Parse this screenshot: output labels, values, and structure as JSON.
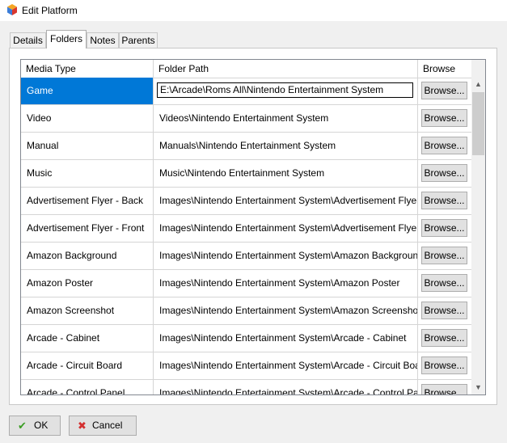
{
  "window": {
    "title": "Edit Platform",
    "icon": "launchbox-cube-icon"
  },
  "tabs": [
    {
      "label": "Details",
      "active": false
    },
    {
      "label": "Folders",
      "active": true
    },
    {
      "label": "Notes",
      "active": false
    },
    {
      "label": "Parents",
      "active": false
    }
  ],
  "grid": {
    "columns": [
      "Media Type",
      "Folder Path",
      "Browse"
    ],
    "rows": [
      {
        "type": "Game",
        "path": "E:\\Arcade\\Roms All\\Nintendo Entertainment System",
        "browse": "Browse...",
        "selected": true
      },
      {
        "type": "Video",
        "path": "Videos\\Nintendo Entertainment System",
        "browse": "Browse..."
      },
      {
        "type": "Manual",
        "path": "Manuals\\Nintendo Entertainment System",
        "browse": "Browse..."
      },
      {
        "type": "Music",
        "path": "Music\\Nintendo Entertainment System",
        "browse": "Browse..."
      },
      {
        "type": "Advertisement Flyer - Back",
        "path": "Images\\Nintendo Entertainment System\\Advertisement Flyer -",
        "browse": "Browse..."
      },
      {
        "type": "Advertisement Flyer - Front",
        "path": "Images\\Nintendo Entertainment System\\Advertisement Flyer -",
        "browse": "Browse..."
      },
      {
        "type": "Amazon Background",
        "path": "Images\\Nintendo Entertainment System\\Amazon Background",
        "browse": "Browse..."
      },
      {
        "type": "Amazon Poster",
        "path": "Images\\Nintendo Entertainment System\\Amazon Poster",
        "browse": "Browse..."
      },
      {
        "type": "Amazon Screenshot",
        "path": "Images\\Nintendo Entertainment System\\Amazon Screenshot",
        "browse": "Browse..."
      },
      {
        "type": "Arcade - Cabinet",
        "path": "Images\\Nintendo Entertainment System\\Arcade - Cabinet",
        "browse": "Browse..."
      },
      {
        "type": "Arcade - Circuit Board",
        "path": "Images\\Nintendo Entertainment System\\Arcade - Circuit Boarc",
        "browse": "Browse..."
      },
      {
        "type": "Arcade - Control Panel",
        "path": "Images\\Nintendo Entertainment System\\Arcade - Control Panc",
        "browse": "Browse..."
      }
    ]
  },
  "footer": {
    "ok_label": "OK",
    "cancel_label": "Cancel",
    "ok_icon": "checkmark-icon",
    "cancel_icon": "x-icon",
    "ok_icon_color": "#3a9d23",
    "cancel_icon_color": "#d32f2f"
  },
  "colors": {
    "selection": "#0078d7",
    "button_face": "#e1e1e1",
    "window_bg": "#f0f0f0"
  }
}
